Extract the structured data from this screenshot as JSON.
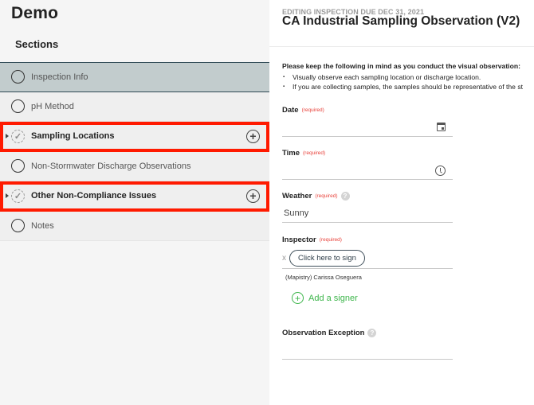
{
  "sidebar": {
    "app_title": "Demo",
    "sections_label": "Sections",
    "items": [
      {
        "label": "Inspection Info",
        "state": "active",
        "icon": "radio-icon"
      },
      {
        "label": "pH Method",
        "state": "normal",
        "icon": "radio-icon"
      },
      {
        "label": "Sampling Locations",
        "state": "group",
        "icon": "check-circle-icon",
        "has_add": true,
        "highlighted": true
      },
      {
        "label": "Non-Stormwater Discharge Observations",
        "state": "normal",
        "icon": "radio-icon"
      },
      {
        "label": "Other Non-Compliance Issues",
        "state": "group",
        "icon": "check-circle-icon",
        "has_add": true,
        "highlighted": true
      },
      {
        "label": "Notes",
        "state": "normal",
        "icon": "radio-icon"
      }
    ],
    "icons": {
      "check": "✓",
      "add": "+",
      "caret": "caret-right-icon"
    }
  },
  "main": {
    "eyebrow": "EDITING INSPECTION DUE DEC 31, 2021",
    "title": "CA Industrial Sampling Observation (V2)",
    "instructions": {
      "title": "Please keep the following in mind as you conduct the visual observation:",
      "bullets": [
        "Visually observe each sampling location or discharge location.",
        "If you are collecting samples, the samples should be representative of the st"
      ]
    },
    "fields": {
      "date": {
        "label": "Date",
        "required": "(required)",
        "value": "",
        "icon": "calendar-icon"
      },
      "time": {
        "label": "Time",
        "required": "(required)",
        "value": "",
        "icon": "clock-icon"
      },
      "weather": {
        "label": "Weather",
        "required": "(required)",
        "help": "?",
        "value": "Sunny"
      },
      "inspector": {
        "label": "Inspector",
        "required": "(required)",
        "clear": "x",
        "sign_button": "Click here to sign",
        "signer_name": "(Mapistry) Carissa Oseguera",
        "add_signer_icon": "+",
        "add_signer": "Add a signer"
      },
      "observation_exception": {
        "label": "Observation Exception",
        "help": "?",
        "value": ""
      }
    }
  },
  "colors": {
    "active_row_bg": "#c2cccd",
    "highlight": "#ff1a00",
    "required": "#e8413a",
    "add_signer": "#3cb54a"
  }
}
